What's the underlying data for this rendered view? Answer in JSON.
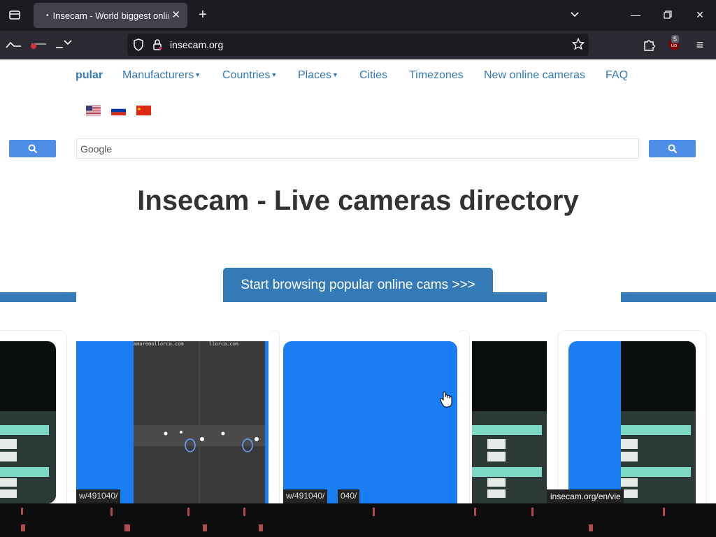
{
  "browser": {
    "tab": {
      "title": "Insecam - World biggest online"
    },
    "url": "insecam.org",
    "extension_badge": "5"
  },
  "menu": [
    {
      "label": "pular",
      "active": true
    },
    {
      "label": "Manufacturers",
      "dropdown": true
    },
    {
      "label": "Countries",
      "dropdown": true
    },
    {
      "label": "Places",
      "dropdown": true
    },
    {
      "label": "Cities"
    },
    {
      "label": "Timezones"
    },
    {
      "label": "New online cameras"
    },
    {
      "label": "FAQ"
    }
  ],
  "flags": [
    "us-flag",
    "ru-flag",
    "cn-flag"
  ],
  "search": {
    "placeholder": "Google"
  },
  "headline": "Insecam - Live cameras directory",
  "cta": "Start browsing popular online cams >>>",
  "thumb_labels": [
    "w/491040/",
    "w/491040/",
    "040/"
  ],
  "status_tip": "insecam.org/en/vie",
  "camera_overlays": {
    "top_left": "amaremallorca.com",
    "top_right": "llorca.com"
  },
  "colors": {
    "link": "#337ab7",
    "button": "#4d8fe8",
    "chrome_dark": "#1c1b22",
    "chrome_nav": "#2b2a33"
  }
}
